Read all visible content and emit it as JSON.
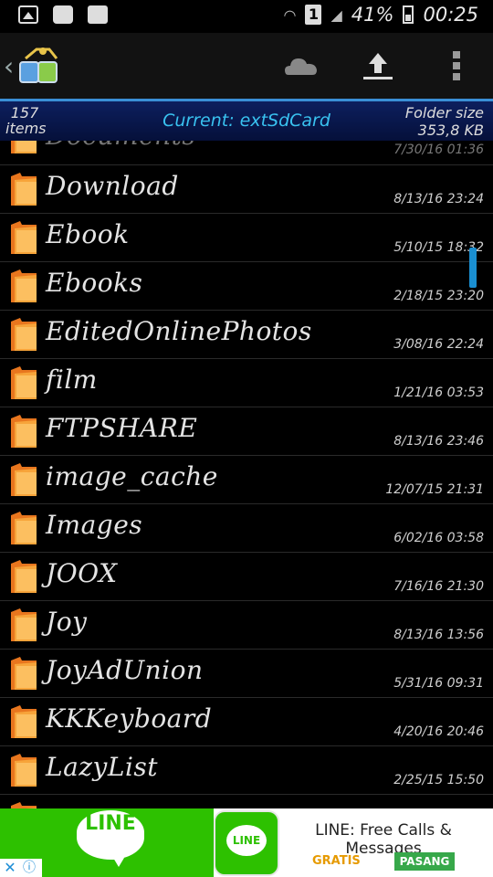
{
  "status_bar": {
    "left_icons": [
      "gallery-icon",
      "chat-icon",
      "gmail-icon"
    ],
    "sim": "1",
    "battery": "41%",
    "time": "00:25"
  },
  "toolbar": {
    "icons": [
      "back-chevron-icon",
      "app-logo-icon",
      "cloud-icon",
      "upload-icon",
      "overflow-menu-icon"
    ]
  },
  "info_bar": {
    "count_number": "157",
    "count_label": "items",
    "current": "Current: extSdCard",
    "folder_size_label": "Folder size",
    "folder_size_value": "353,8 KB"
  },
  "files": [
    {
      "name": "Documents",
      "date": "7/30/16 01:36"
    },
    {
      "name": "Download",
      "date": "8/13/16 23:24"
    },
    {
      "name": "Ebook",
      "date": "5/10/15 18:32"
    },
    {
      "name": "Ebooks",
      "date": "2/18/15 23:20"
    },
    {
      "name": "EditedOnlinePhotos",
      "date": "3/08/16 22:24"
    },
    {
      "name": "film",
      "date": "1/21/16 03:53"
    },
    {
      "name": "FTPSHARE",
      "date": "8/13/16 23:46"
    },
    {
      "name": "image_cache",
      "date": "12/07/15 21:31"
    },
    {
      "name": "Images",
      "date": "6/02/16 03:58"
    },
    {
      "name": "JOOX",
      "date": "7/16/16 21:30"
    },
    {
      "name": "Joy",
      "date": "8/13/16 13:56"
    },
    {
      "name": "JoyAdUnion",
      "date": "5/31/16 09:31"
    },
    {
      "name": "KKKeyboard",
      "date": "4/20/16 20:46"
    },
    {
      "name": "LazyList",
      "date": "2/25/15 15:50"
    },
    {
      "name": "",
      "date": ""
    }
  ],
  "ad": {
    "brand": "LINE",
    "icon_text": "LINE",
    "title": "LINE: Free Calls & Messages",
    "gratis": "GRATIS",
    "install": "PASANG",
    "close": "✕",
    "info": "ⓘ",
    "colors": {
      "brand_green": "#2dc100",
      "install_green": "#37a84a",
      "gratis_orange": "#e69a00"
    }
  },
  "colors": {
    "accent": "#39c2f0",
    "infobar_bg": "#0d1f5e",
    "scroll_thumb": "#1a8fd1"
  }
}
